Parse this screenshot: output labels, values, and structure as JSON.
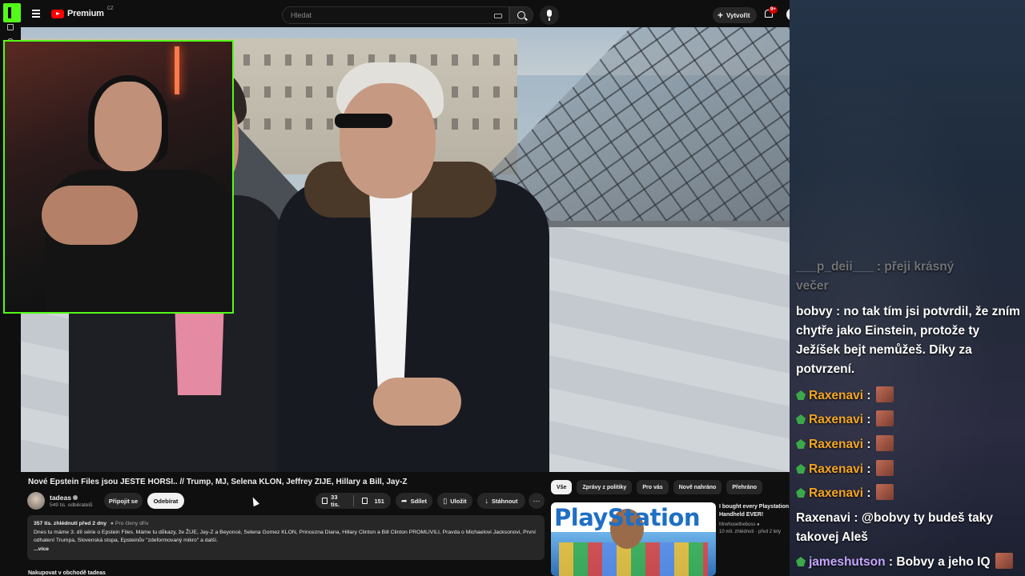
{
  "topbar": {
    "logo_text": "Premium",
    "logo_region": "CZ",
    "search_placeholder": "Hledat",
    "create_label": "Vytvořit",
    "notifications_badge": "9+"
  },
  "video": {
    "title": "Nové Epstein Files jsou JEŠTĚ HORŠÍ.. // Trump, MJ, Selena KLON, Jeffrey ŽIJE, Hillary a Bill, Jay-Z",
    "channel": {
      "name": "tadeas",
      "subscribers": "549 tis. odběratelů",
      "join_label": "Připojit se",
      "subscribe_label": "Odebírat"
    },
    "actions": {
      "likes": "33 tis.",
      "dislikes": "151",
      "share": "Sdílet",
      "save": "Uložit",
      "download": "Stáhnout"
    },
    "description": {
      "meta": "357 tis. zhlédnutí  před 2 dny",
      "member_note": "Pro členy dřív",
      "text": "Dnes tu máme 3. díl série o Epstein Files. Máme tu důkazy, že ŽIJE, Jay-Z a Beyoncé, Selena Gomez KLON, Princezna Diana, Hillary Clinton a Bill Clinton PROMLIVILI, Pravda o Michaelovi Jacksonovi, První odhalení Trumpa, Slovenská stopa, Epsteinův \"zdeformovaný mikro\" a další.",
      "more": "...více"
    },
    "shop_label": "Nakupovat v obchodě tadeas"
  },
  "related": {
    "chips": [
      "Vše",
      "Zprávy z politiky",
      "Pro vás",
      "Nově nahráno",
      "Přehráno"
    ],
    "active_chip": 0,
    "item": {
      "thumb_text": "PlayStation",
      "title": "I bought every Playstation Handheld EVER!",
      "channel": "Mrwhosetheboss",
      "meta": "10 mil. zhlédnutí · před 2 lety"
    }
  },
  "chat": {
    "faded_line_1": "___p_deii___ : přeji krásný",
    "faded_line_2": "večer",
    "message_bobvy": {
      "user": "bobvy",
      "text": ": no tak tím jsi potvrdil, že zním chytře jako Einstein, protože ty Ježíšek bejt nemůžeš. Díky za potvrzení."
    },
    "repeated_user": "Raxenavi",
    "repeated_sep": ":",
    "raxenavi_mention": ": @bobvy ty budeš taky takovej Aleš",
    "last_user": "jameshutson",
    "last_text": ": Bobvy a jeho IQ"
  },
  "colors": {
    "kick_green": "#53fc18",
    "yt_red": "#ff0000",
    "chat_username": "#f5a623"
  }
}
